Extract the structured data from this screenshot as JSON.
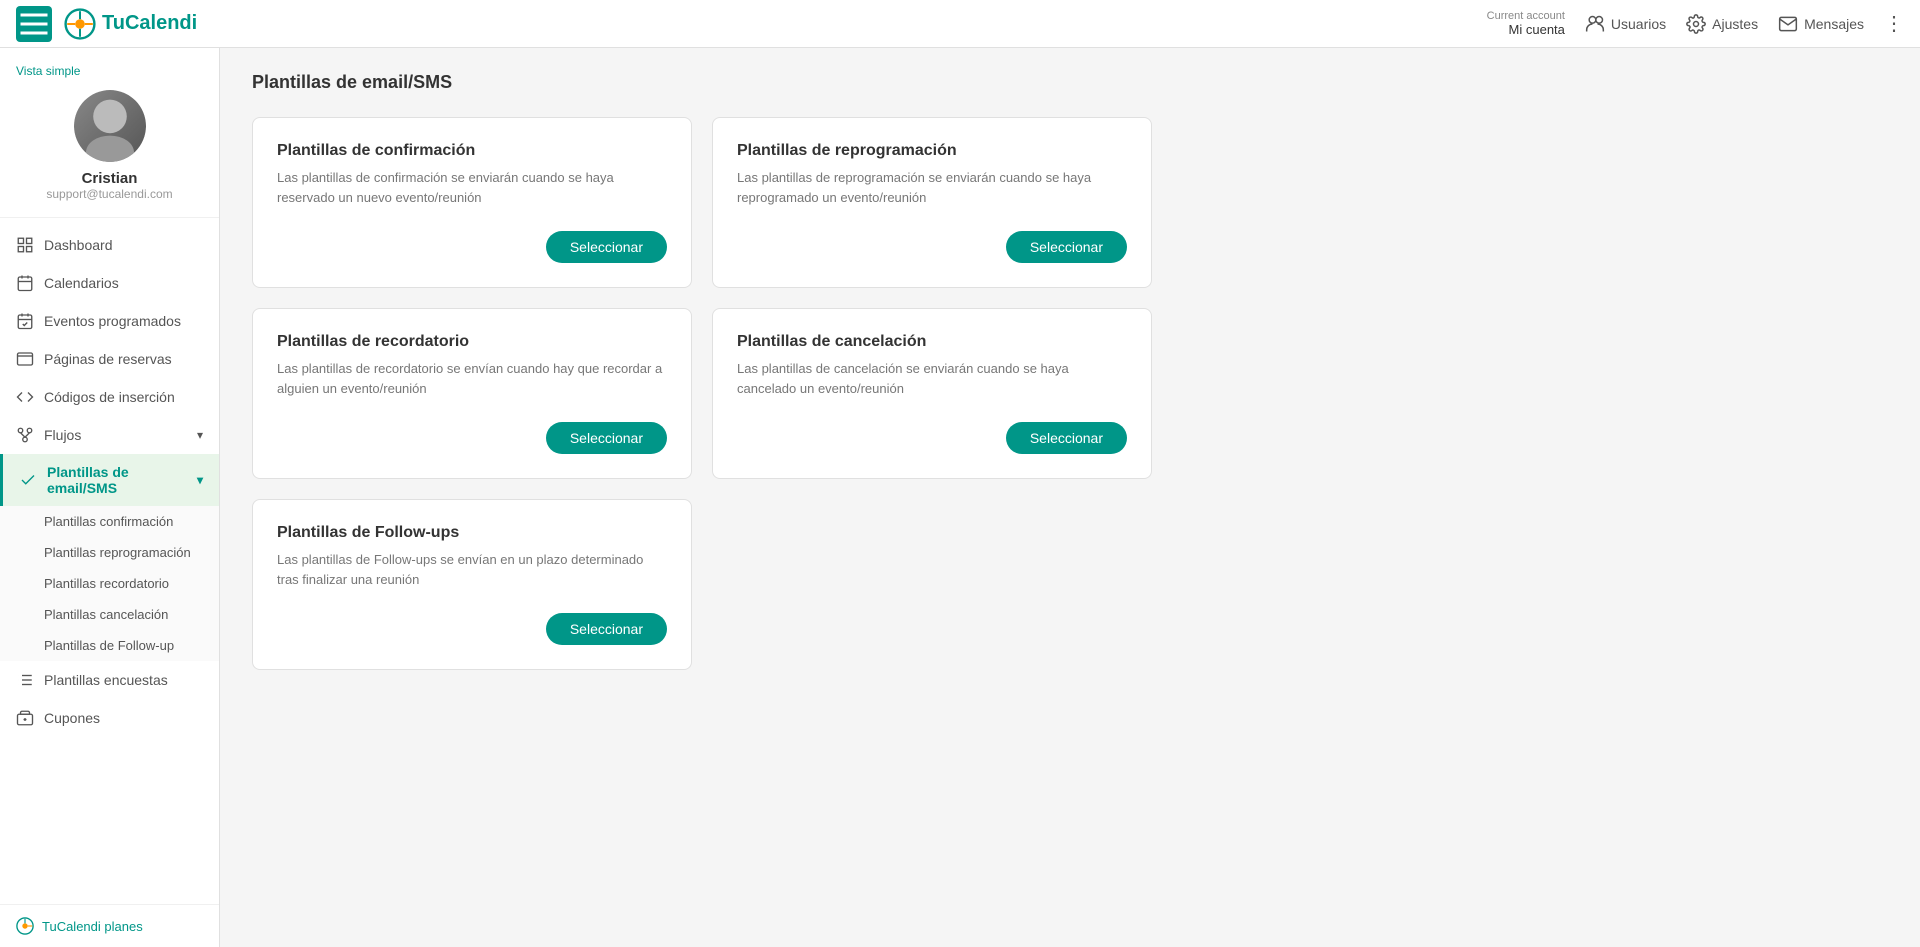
{
  "brand": {
    "name": "TuCalendi"
  },
  "topbar": {
    "current_account_label": "Current account",
    "mi_cuenta": "Mi cuenta",
    "usuarios": "Usuarios",
    "ajustes": "Ajustes",
    "mensajes": "Mensajes"
  },
  "sidebar": {
    "vista_simple": "Vista simple",
    "user": {
      "name": "Cristian",
      "email": "support@tucalendi.com"
    },
    "nav_items": [
      {
        "id": "dashboard",
        "label": "Dashboard"
      },
      {
        "id": "calendarios",
        "label": "Calendarios"
      },
      {
        "id": "eventos-programados",
        "label": "Eventos programados"
      },
      {
        "id": "paginas-de-reservas",
        "label": "Páginas de reservas"
      },
      {
        "id": "codigos-de-insercion",
        "label": "Códigos de inserción"
      },
      {
        "id": "flujos",
        "label": "Flujos",
        "has_chevron": true
      },
      {
        "id": "plantillas-email-sms",
        "label": "Plantillas de email/SMS",
        "active": true,
        "has_chevron": true
      }
    ],
    "subnav": [
      {
        "id": "plantillas-confirmacion",
        "label": "Plantillas confirmación"
      },
      {
        "id": "plantillas-reprogramacion",
        "label": "Plantillas reprogramación"
      },
      {
        "id": "plantillas-recordatorio",
        "label": "Plantillas recordatorio"
      },
      {
        "id": "plantillas-cancelacion",
        "label": "Plantillas cancelación"
      },
      {
        "id": "plantillas-followup",
        "label": "Plantillas de Follow-up"
      }
    ],
    "extra_items": [
      {
        "id": "plantillas-encuestas",
        "label": "Plantillas encuestas"
      },
      {
        "id": "cupones",
        "label": "Cupones"
      }
    ],
    "footer": {
      "plans_label": "TuCalendi planes"
    }
  },
  "main": {
    "page_title": "Plantillas de email/SMS",
    "cards": [
      {
        "id": "confirmacion",
        "title": "Plantillas de confirmación",
        "description": "Las plantillas de confirmación se enviarán cuando se haya reservado un nuevo evento/reunión",
        "button_label": "Seleccionar"
      },
      {
        "id": "reprogramacion",
        "title": "Plantillas de reprogramación",
        "description": "Las plantillas de reprogramación se enviarán cuando se haya reprogramado un evento/reunión",
        "button_label": "Seleccionar"
      },
      {
        "id": "recordatorio",
        "title": "Plantillas de recordatorio",
        "description": "Las plantillas de recordatorio se envían cuando hay que recordar a alguien un evento/reunión",
        "button_label": "Seleccionar"
      },
      {
        "id": "cancelacion",
        "title": "Plantillas de cancelación",
        "description": "Las plantillas de cancelación se enviarán cuando se haya cancelado un evento/reunión",
        "button_label": "Seleccionar"
      },
      {
        "id": "followups",
        "title": "Plantillas de Follow-ups",
        "description": "Las plantillas de Follow-ups se envían en un plazo determinado tras finalizar una reunión",
        "button_label": "Seleccionar"
      }
    ]
  }
}
